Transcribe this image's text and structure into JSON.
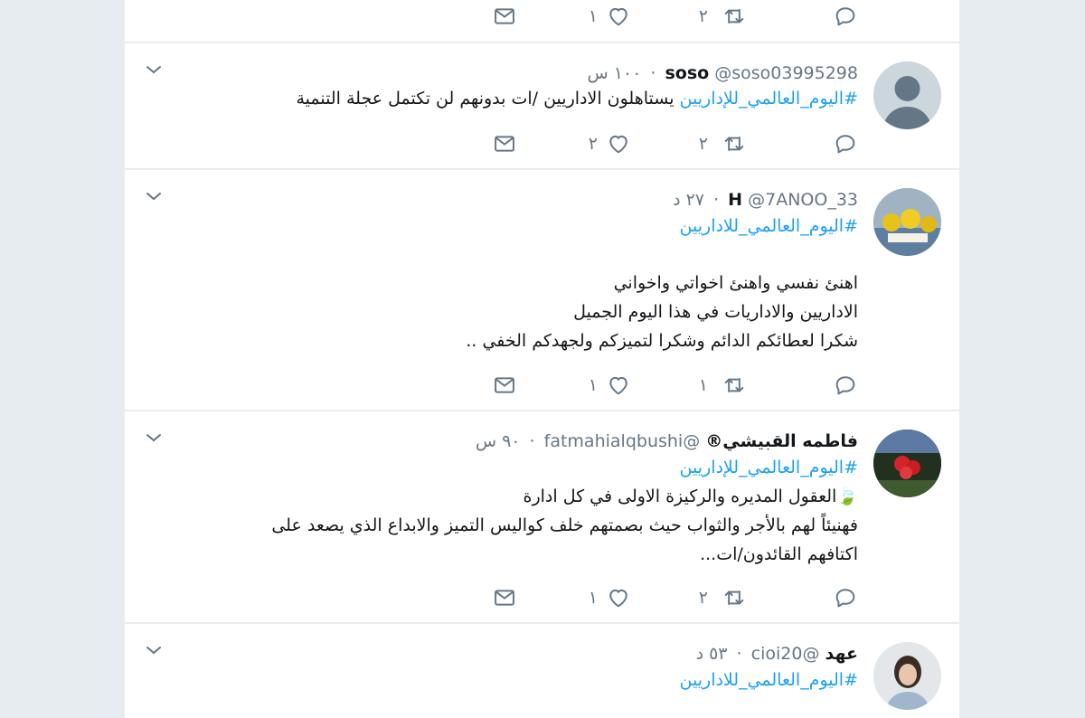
{
  "tweets": [
    {
      "id": "t0",
      "name": "",
      "handle": "",
      "time": "",
      "lines": [],
      "reply_count": "",
      "retweet_count": "٢",
      "like_count": "١"
    },
    {
      "id": "t1",
      "name": "soso",
      "handle": "@soso03995298",
      "time": "١٠٠ س",
      "lines": [
        {
          "hashtag": "#اليوم_العالمي_للإداريين",
          "text": " يستاهلون الاداريين /ات بدونهم لن تكتمل عجلة التنمية"
        }
      ],
      "retweet_count": "٢",
      "like_count": "٢"
    },
    {
      "id": "t2",
      "name": "H",
      "handle": "@7ANOO_33",
      "time": "٢٧ د",
      "lines": [
        {
          "hashtag": "#اليوم_العالمي_للاداريين",
          "text": ""
        },
        {
          "hashtag": "",
          "text": "اهنئ نفسي واهنئ اخواتي واخواني"
        },
        {
          "hashtag": "",
          "text": "الاداريين والاداريات في هذا اليوم الجميل"
        },
        {
          "hashtag": "",
          "text": "شكرا لعطائكم الدائم وشكرا لتميزكم ولجهدكم الخفي .."
        }
      ],
      "retweet_count": "١",
      "like_count": "١"
    },
    {
      "id": "t3",
      "name": "فاطمه القبيشي®",
      "handle": "@fatmahialqbushi",
      "time": "٩٠ س",
      "lines": [
        {
          "hashtag": "#اليوم_العالمي_للإداريين",
          "text": ""
        },
        {
          "hashtag": "",
          "text": "🍃العقول المديره والركيزة الاولى في كل ادارة"
        },
        {
          "hashtag": "",
          "text": "فهنيئاً لهم بالأجر والثواب حيث بصمتهم خلف كواليس التميز والابداع الذي يصعد على"
        },
        {
          "hashtag": "",
          "text": "اكتافهم القائدون/ات..."
        }
      ],
      "retweet_count": "٢",
      "like_count": "١"
    },
    {
      "id": "t4",
      "name": "عهد",
      "handle": "@cioi20",
      "time": "٥٣ د",
      "lines": [
        {
          "hashtag": "#اليوم_العالمي_للاداريين",
          "text": ""
        }
      ],
      "retweet_count": "",
      "like_count": ""
    }
  ],
  "icons": {
    "reply": "reply-icon",
    "retweet": "retweet-icon",
    "like": "like-icon",
    "message": "message-icon",
    "caret": "chevron-down-icon"
  },
  "colors": {
    "background": "#e6ecf0",
    "card": "#ffffff",
    "link": "#1da1f2",
    "secondary_text": "#657786",
    "icon": "#657786"
  }
}
